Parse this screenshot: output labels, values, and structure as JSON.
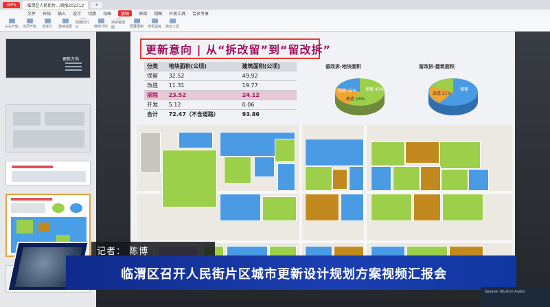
{
  "window": {
    "tabs": [
      "WPS",
      "临渭区人民街片…周报202312",
      "+"
    ],
    "menus": [
      "文件",
      "开始",
      "插入",
      "设计",
      "切换",
      "动画",
      "放映",
      "审阅",
      "视图",
      "开发工具",
      "会员专享"
    ],
    "active_menu": "放映",
    "toolbar": [
      "从头开始",
      "当页开始",
      "自定义",
      "放映设置",
      "隐藏幻灯片",
      "排练计时",
      "演讲者视图",
      "屏幕录制",
      "手机遥控",
      "演示工具"
    ]
  },
  "thumbnail": {
    "title": "更新方向"
  },
  "slide": {
    "title": "更新意向 | 从“拆改留”到“留改拆”",
    "table": {
      "headers": [
        "分类",
        "地块面积(公顷)",
        "建筑面积(公顷)"
      ],
      "rows": [
        [
          "保留",
          "32.52",
          "49.92"
        ],
        [
          "改造",
          "11.31",
          "19.77"
        ],
        [
          "拆除",
          "23.52",
          "24.12"
        ],
        [
          "开发",
          "5.12",
          "0.06"
        ],
        [
          "合计",
          "72.47（不含道路）",
          "93.86"
        ]
      ]
    },
    "pie1": {
      "title": "留改拆-地块面积",
      "labels": [
        "拆除 32%",
        "改造 16%",
        "保留 45%"
      ]
    },
    "pie2": {
      "title": "留改拆-建筑面积",
      "labels": [
        "改造 21%",
        "保留"
      ]
    },
    "colors": {
      "keep": "#4a9be4",
      "renovate": "#9ccf4a",
      "demolish": "#c28a1e",
      "develop": "#b9a8d6",
      "title": "#a3125e",
      "frame": "#e5392b"
    }
  },
  "caption": {
    "reporter": "记者：  陈博",
    "headline": "临渭区召开人民街片区城市更新设计规划方案视频汇报会"
  },
  "status": {
    "text": "Speaker (Built-in Audio)"
  }
}
